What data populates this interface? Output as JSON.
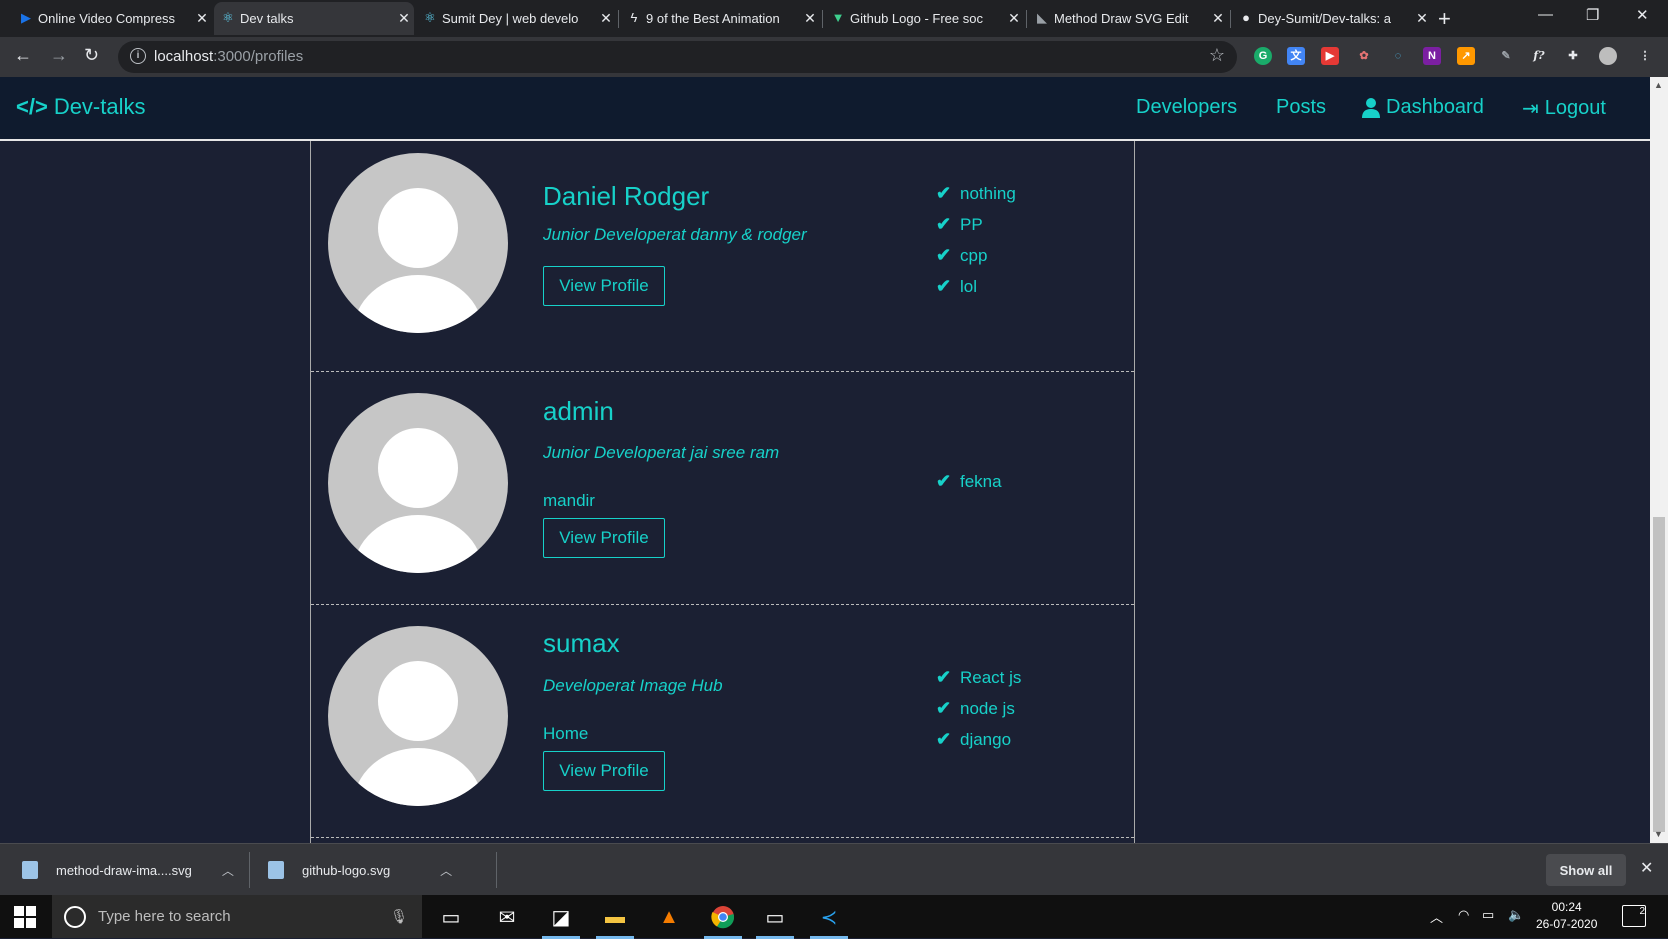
{
  "browser": {
    "tabs": [
      {
        "title": "Online Video Compress",
        "icon": "play-icon",
        "color": "#1a73e8"
      },
      {
        "title": "Dev talks",
        "icon": "react-icon",
        "color": "#61dafb"
      },
      {
        "title": "Sumit Dey | web develo",
        "icon": "react-icon",
        "color": "#61dafb"
      },
      {
        "title": "9 of the Best Animation",
        "icon": "bolt-icon",
        "color": "#e8eaed"
      },
      {
        "title": "Github Logo - Free soc",
        "icon": "vector-icon",
        "color": "#3ecf8e"
      },
      {
        "title": "Method Draw SVG Edit",
        "icon": "method-draw-icon",
        "color": "#9aa0a6"
      },
      {
        "title": "Dey-Sumit/Dev-talks: a",
        "icon": "github-icon",
        "color": "#e8eaed"
      }
    ],
    "url_host": "localhost",
    "url_path": ":3000/profiles"
  },
  "app": {
    "brand": "Dev-talks",
    "nav": {
      "developers": "Developers",
      "posts": "Posts",
      "dashboard": "Dashboard",
      "logout": "Logout"
    },
    "accent": "#17d1c9",
    "profiles": [
      {
        "name": "Daniel Rodger",
        "status": "Junior Developerat danny & rodger",
        "location": "",
        "button": "View Profile",
        "skills": [
          "nothing",
          "PP",
          "cpp",
          "lol"
        ]
      },
      {
        "name": "admin",
        "status": "Junior Developerat jai sree ram",
        "location": "mandir",
        "button": "View Profile",
        "skills": [
          "fekna"
        ]
      },
      {
        "name": "sumax",
        "status": "Developerat Image Hub",
        "location": "Home",
        "button": "View Profile",
        "skills": [
          "React js",
          "node js",
          "django"
        ]
      }
    ]
  },
  "downloads": {
    "items": [
      "method-draw-ima....svg",
      "github-logo.svg"
    ],
    "show_all": "Show all"
  },
  "taskbar": {
    "search_placeholder": "Type here to search",
    "time": "00:24",
    "date": "26-07-2020",
    "notification_count": "2"
  }
}
